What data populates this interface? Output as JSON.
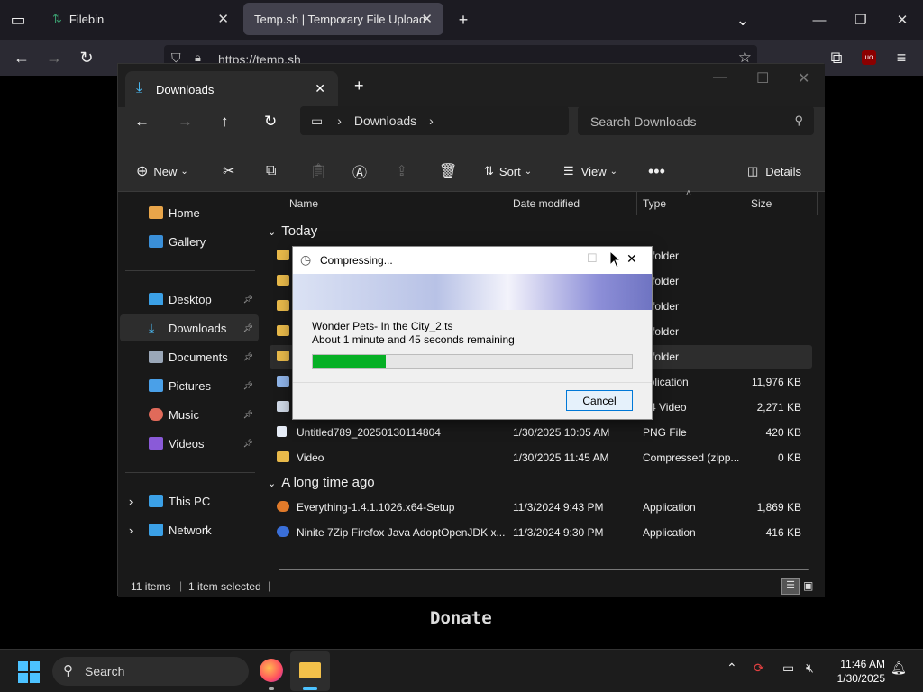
{
  "browser": {
    "tabs": [
      {
        "label": "Filebin",
        "active": false
      },
      {
        "label": "Temp.sh | Temporary File Upload",
        "active": true
      }
    ],
    "url": "https://temp.sh",
    "page_text": "Donate"
  },
  "explorer": {
    "tab_title": "Downloads",
    "breadcrumb": "Downloads",
    "search_placeholder": "Search Downloads",
    "toolbar": {
      "new": "New",
      "sort": "Sort",
      "view": "View",
      "details": "Details"
    },
    "sidebar": [
      {
        "label": "Home",
        "icon": "home-icon",
        "pinned": false
      },
      {
        "label": "Gallery",
        "icon": "gallery-icon",
        "pinned": false
      },
      {
        "label": "Desktop",
        "icon": "desktop-icon",
        "pinned": true
      },
      {
        "label": "Downloads",
        "icon": "downloads-icon",
        "pinned": true,
        "selected": true
      },
      {
        "label": "Documents",
        "icon": "documents-icon",
        "pinned": true
      },
      {
        "label": "Pictures",
        "icon": "pictures-icon",
        "pinned": true
      },
      {
        "label": "Music",
        "icon": "music-icon",
        "pinned": true
      },
      {
        "label": "Videos",
        "icon": "videos-icon",
        "pinned": true
      },
      {
        "label": "This PC",
        "icon": "pc-icon",
        "pinned": false
      },
      {
        "label": "Network",
        "icon": "network-icon",
        "pinned": false
      }
    ],
    "columns": {
      "name": "Name",
      "date": "Date modified",
      "type": "Type",
      "size": "Size"
    },
    "groups": {
      "today": "Today",
      "old": "A long time ago"
    },
    "today_rows": [
      {
        "name": "",
        "date": "",
        "type": "e folder",
        "size": ""
      },
      {
        "name": "",
        "date": "",
        "type": "e folder",
        "size": ""
      },
      {
        "name": "",
        "date": "",
        "type": "e folder",
        "size": ""
      },
      {
        "name": "",
        "date": "",
        "type": "e folder",
        "size": ""
      },
      {
        "name": "",
        "date": "",
        "type": "e folder",
        "size": "",
        "selected": true
      },
      {
        "name": "",
        "date": "",
        "type": "pplication",
        "size": "11,976 KB"
      },
      {
        "name": "",
        "date": "",
        "type": "P4 Video",
        "size": "2,271 KB"
      },
      {
        "name": "Untitled789_20250130114804",
        "date": "1/30/2025 10:05 AM",
        "type": "PNG File",
        "size": "420 KB"
      },
      {
        "name": "Video",
        "date": "1/30/2025 11:45 AM",
        "type": "Compressed (zipp...",
        "size": "0 KB"
      }
    ],
    "old_rows": [
      {
        "name": "Everything-1.4.1.1026.x64-Setup",
        "date": "11/3/2024 9:43 PM",
        "type": "Application",
        "size": "1,869 KB"
      },
      {
        "name": "Ninite 7Zip Firefox Java AdoptOpenJDK x...",
        "date": "11/3/2024 9:30 PM",
        "type": "Application",
        "size": "416 KB"
      }
    ],
    "status": {
      "items": "11 items",
      "selected": "1 item selected"
    }
  },
  "dialog": {
    "title": "Compressing...",
    "filename": "Wonder Pets- In the City_2.ts",
    "remaining": "About 1 minute and 45 seconds remaining",
    "progress": 0.23,
    "cancel": "Cancel"
  },
  "taskbar": {
    "search": "Search",
    "time": "11:46 AM",
    "date": "1/30/2025"
  },
  "colors": {
    "progress": "#06b025",
    "accent": "#0078d7"
  }
}
